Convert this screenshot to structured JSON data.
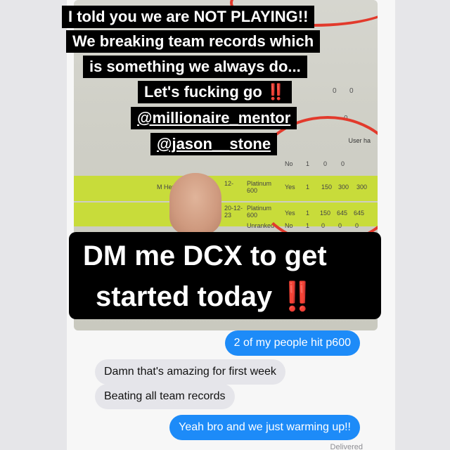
{
  "captions": {
    "line1": "I told you we are NOT PLAYING!!",
    "line2": "We breaking team records which",
    "line3": "is something we always do...",
    "line4": "Let's fucking go",
    "line4_emoji": "‼️",
    "line5": "@millionaire_mentor",
    "line6": "@jason__stone",
    "dm_line1": "DM me DCX to get",
    "dm_line2": "started today",
    "dm_emoji": "‼️"
  },
  "spreadsheet": {
    "header_user": "User ha",
    "rows": [
      {
        "rank": "Platinum\n600",
        "date": "12-",
        "name": "M Her",
        "status": "Yes",
        "n": "1",
        "a": "150",
        "b": "300",
        "c": "300",
        "highlight": true
      },
      {
        "rank": "Platinum\n600",
        "date": "20-12-\n23",
        "name": "",
        "status": "Yes",
        "n": "1",
        "a": "150",
        "b": "645",
        "c": "645",
        "highlight": true
      },
      {
        "rank": "Unranked",
        "date": "",
        "name": "",
        "status": "No",
        "n": "1",
        "a": "0",
        "b": "0",
        "c": "0",
        "highlight": false
      }
    ],
    "upper_row": {
      "status": "No",
      "n": "1",
      "a": "0",
      "b": "0"
    }
  },
  "messages": [
    {
      "side": "sent",
      "text": "2 of my people hit p600"
    },
    {
      "side": "received",
      "text": "Damn that's amazing for first week"
    },
    {
      "side": "received",
      "text": "Beating all team records"
    },
    {
      "side": "sent",
      "text": "Yeah bro and we just warming up!!"
    }
  ],
  "delivered_label": "Delivered",
  "colors": {
    "accent_blue": "#1d8bf8",
    "circle_red": "#e23a2c",
    "highlight_green": "#c8dc3a"
  }
}
